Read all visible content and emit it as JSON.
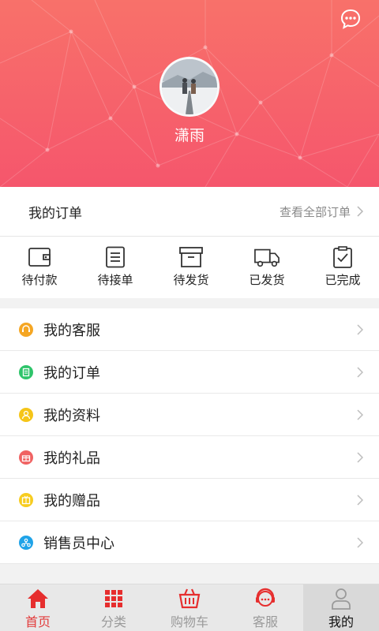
{
  "profile": {
    "username": "潇雨"
  },
  "header": {
    "message_icon": "chat-bubble-icon",
    "avatar_alt": "avatar-photo"
  },
  "orders": {
    "title": "我的订单",
    "view_all": "查看全部订单",
    "items": [
      {
        "label": "待付款",
        "icon": "wallet-icon"
      },
      {
        "label": "待接单",
        "icon": "list-doc-icon"
      },
      {
        "label": "待发货",
        "icon": "box-icon"
      },
      {
        "label": "已发货",
        "icon": "truck-icon"
      },
      {
        "label": "已完成",
        "icon": "clipboard-check-icon"
      }
    ]
  },
  "menu": [
    {
      "label": "我的客服",
      "icon": "headset-icon",
      "color": "#f5a623"
    },
    {
      "label": "我的订单",
      "icon": "order-icon",
      "color": "#2ec46a"
    },
    {
      "label": "我的资料",
      "icon": "profile-icon",
      "color": "#f5c518"
    },
    {
      "label": "我的礼品",
      "icon": "gift-icon",
      "color": "#f06262"
    },
    {
      "label": "我的赠品",
      "icon": "present-icon",
      "color": "#f7cc1f"
    },
    {
      "label": "销售员中心",
      "icon": "sales-network-icon",
      "color": "#1fa3e8"
    }
  ],
  "tabbar": [
    {
      "label": "首页",
      "icon": "home-icon"
    },
    {
      "label": "分类",
      "icon": "grid-icon"
    },
    {
      "label": "购物车",
      "icon": "cart-icon"
    },
    {
      "label": "客服",
      "icon": "headset-icon"
    },
    {
      "label": "我的",
      "icon": "user-icon"
    }
  ],
  "colors": {
    "accent": "#e62e2e",
    "header_top": "#f8716a",
    "header_bottom": "#f5566c"
  }
}
